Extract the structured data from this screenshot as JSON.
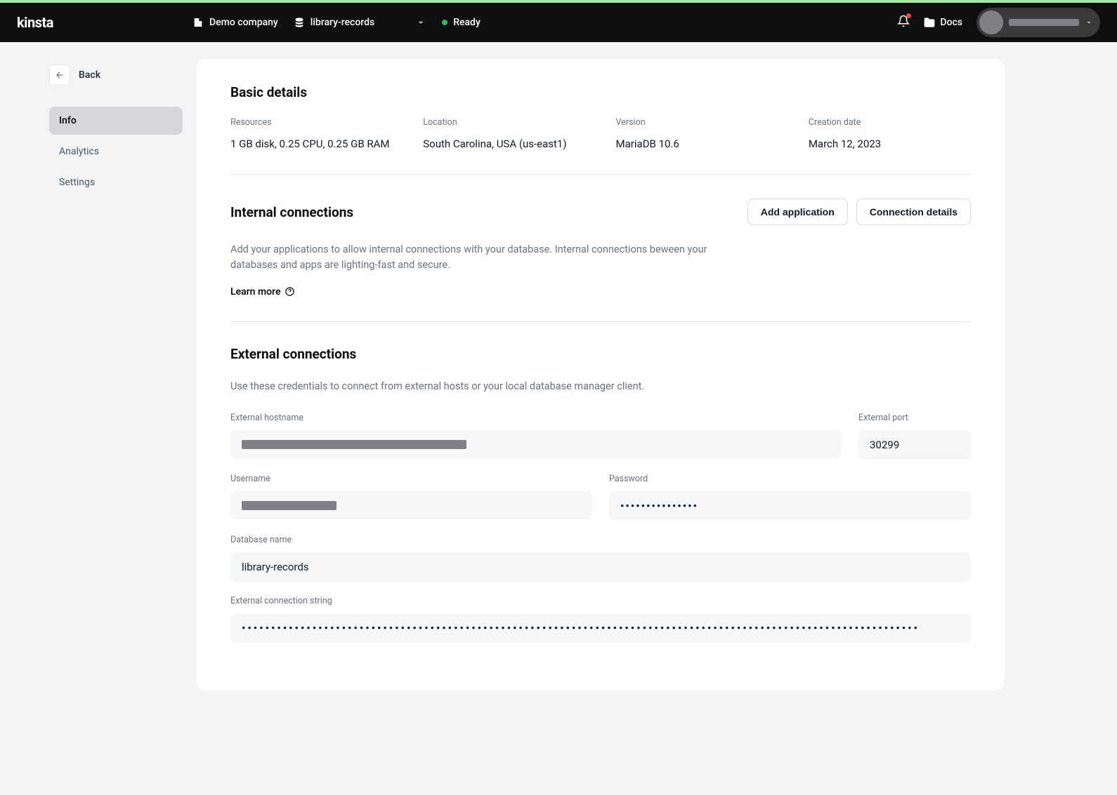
{
  "header": {
    "logo": "kinsta",
    "company": "Demo company",
    "database": "library-records",
    "status": "Ready",
    "docs_label": "Docs"
  },
  "sidebar": {
    "back_label": "Back",
    "items": [
      {
        "label": "Info",
        "active": true
      },
      {
        "label": "Analytics",
        "active": false
      },
      {
        "label": "Settings",
        "active": false
      }
    ]
  },
  "basic": {
    "title": "Basic details",
    "resources_label": "Resources",
    "resources_value": "1 GB disk, 0.25 CPU, 0.25 GB RAM",
    "location_label": "Location",
    "location_value": "South Carolina, USA (us-east1)",
    "version_label": "Version",
    "version_value": "MariaDB 10.6",
    "creation_label": "Creation date",
    "creation_value": "March 12, 2023"
  },
  "internal": {
    "title": "Internal connections",
    "add_app_label": "Add application",
    "conn_details_label": "Connection details",
    "desc": "Add your applications to allow internal connections with your database. Internal connections beween your databases and apps are lighting-fast and secure.",
    "learn_more": "Learn more"
  },
  "external": {
    "title": "External connections",
    "desc": "Use these credentials to connect from external hosts or your local database manager client.",
    "hostname_label": "External hostname",
    "port_label": "External port",
    "port_value": "30299",
    "username_label": "Username",
    "password_label": "Password",
    "password_value": "•••••••••••••••",
    "dbname_label": "Database name",
    "dbname_value": "library-records",
    "connstr_label": "External connection string",
    "connstr_value": "•••••••••••••••••••••••••••••••••••••••••••••••••••••••••••••••••••••••••••••••••••••••••••••••••••••••••••••••••••"
  }
}
